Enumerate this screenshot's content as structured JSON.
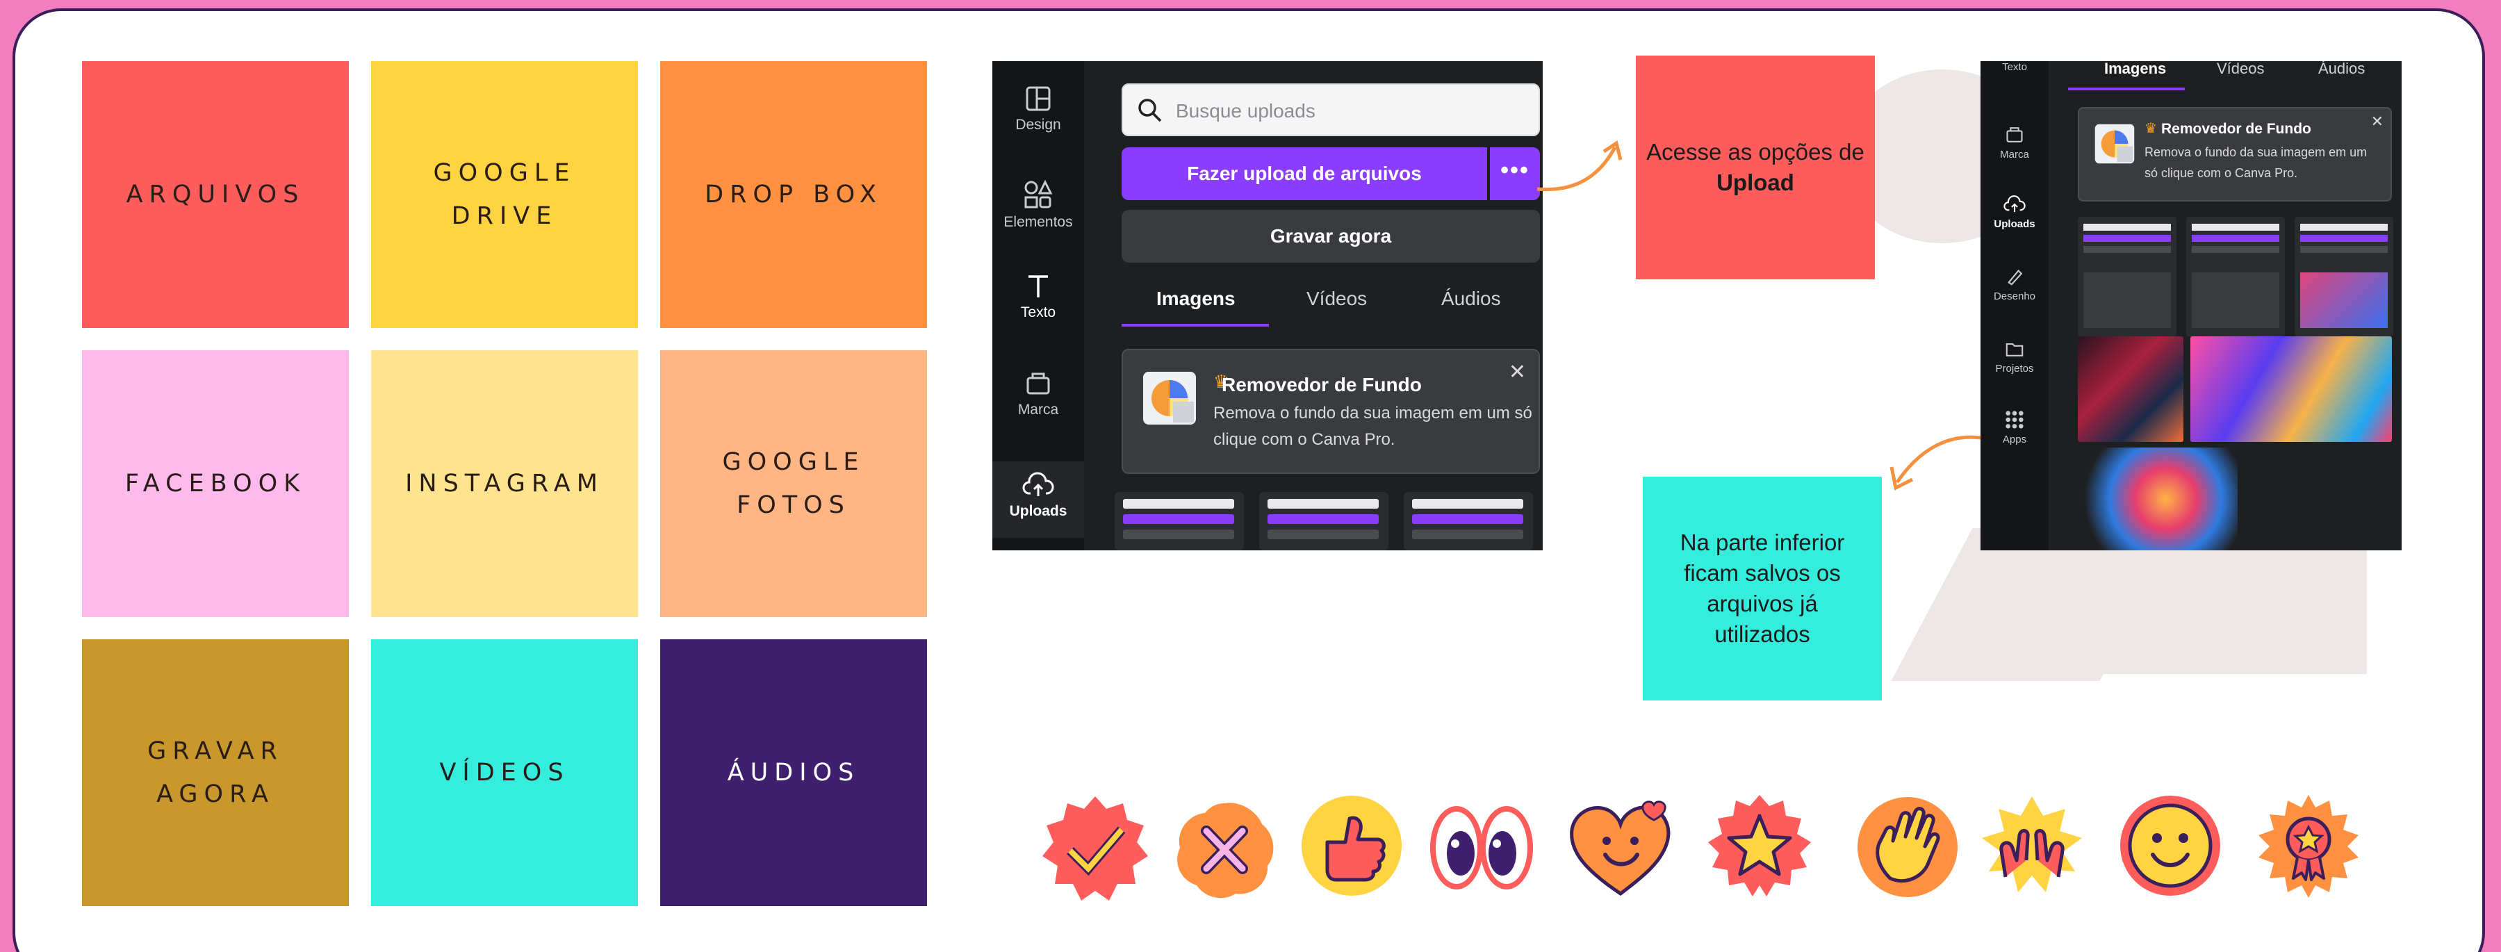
{
  "tiles": [
    {
      "label": "ARQUIVOS",
      "color": "#ff5c5c"
    },
    {
      "label": "GOOGLE DRIVE",
      "color": "#ffd342"
    },
    {
      "label": "DROP BOX",
      "color": "#ff9140"
    },
    {
      "label": "FACEBOOK",
      "color": "#ffbaed"
    },
    {
      "label": "INSTAGRAM",
      "color": "#ffe490"
    },
    {
      "label": "GOOGLE FOTOS",
      "color": "#ffb684"
    },
    {
      "label": "GRAVAR AGORA",
      "color": "#c9982c"
    },
    {
      "label": "VÍDEOS",
      "color": "#35eddc"
    },
    {
      "label": "ÁUDIOS",
      "color": "#3f206e"
    }
  ],
  "panel": {
    "rail": [
      "Design",
      "Elementos",
      "Texto",
      "Marca",
      "Uploads"
    ],
    "search_placeholder": "Busque uploads",
    "upload_button": "Fazer upload de arquivos",
    "more_button": "•••",
    "record_button": "Gravar agora",
    "tabs": [
      "Imagens",
      "Vídeos",
      "Áudios"
    ],
    "card": {
      "title": "Removedor de Fundo",
      "crown": "♛",
      "description": "Remova o fundo da sua imagem em um só clique com o Canva Pro.",
      "close": "✕"
    }
  },
  "panel2": {
    "rail": [
      "Texto",
      "Marca",
      "Uploads",
      "Desenho",
      "Projetos",
      "Apps"
    ],
    "tabs": [
      "Imagens",
      "Vídeos",
      "Áudios"
    ],
    "card": {
      "title": "Removedor de Fundo",
      "crown": "♛",
      "description": "Remova o fundo da sua imagem em um só clique com o Canva Pro.",
      "close": "✕"
    }
  },
  "callouts": {
    "upload_prefix": "Acesse as opções de",
    "upload_bold": "Upload",
    "bottom": "Na parte inferior ficam salvos os arquivos já utilizados"
  },
  "colors": {
    "background": "#f27ec0",
    "accent_purple": "#8b3dff",
    "callout_red": "#ff5c5c",
    "callout_teal": "#35eddc",
    "arrow_orange": "#f5913e"
  },
  "stickers": [
    "check-badge-icon",
    "x-badge-icon",
    "thumbs-up-icon",
    "eyes-icon",
    "heart-smile-icon",
    "star-badge-icon",
    "hand-wave-icon",
    "celebrate-hands-icon",
    "smiley-icon",
    "award-badge-icon"
  ]
}
